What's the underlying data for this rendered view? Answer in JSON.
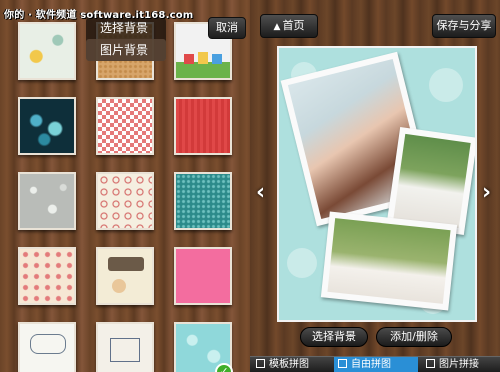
{
  "watermark": "你的 · 软件频道 software.it168.com",
  "left_panel": {
    "menu": {
      "items": [
        "选择背景",
        "图片背景"
      ],
      "selected_index": 1
    },
    "cancel_label": "取消",
    "thumbnails": [
      {
        "name": "pattern-doodle"
      },
      {
        "name": "pattern-cork"
      },
      {
        "name": "pattern-toys"
      },
      {
        "name": "pattern-bokeh"
      },
      {
        "name": "pattern-checker"
      },
      {
        "name": "pattern-red-stripes"
      },
      {
        "name": "pattern-raindrops"
      },
      {
        "name": "pattern-circles"
      },
      {
        "name": "pattern-teal-grid"
      },
      {
        "name": "pattern-flowers"
      },
      {
        "name": "pattern-cartoon"
      },
      {
        "name": "pattern-pink"
      },
      {
        "name": "pattern-sketch"
      },
      {
        "name": "pattern-house"
      },
      {
        "name": "pattern-aqua-bubbles",
        "selected": true
      }
    ],
    "check_glyph": "✓"
  },
  "right_panel": {
    "home_label": "首页",
    "home_glyph": "▲",
    "save_label": "保存与分享",
    "prev_glyph": "‹",
    "next_glyph": "›",
    "select_bg_label": "选择背景",
    "add_remove_label": "添加/删除",
    "tabs": [
      {
        "label": "模板拼图"
      },
      {
        "label": "自由拼图",
        "active": true
      },
      {
        "label": "图片拼接"
      }
    ]
  },
  "colors": {
    "canvas_background": "#aee0de",
    "active_tab": "#2a8fd6",
    "check": "#3fae29"
  }
}
